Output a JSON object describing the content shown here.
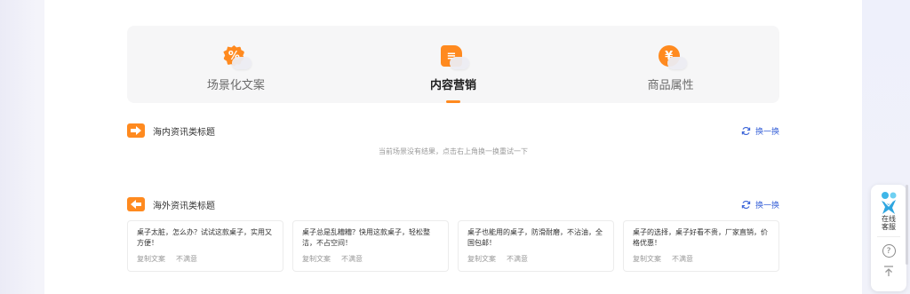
{
  "tabs": [
    {
      "label": "场景化文案",
      "icon": "percent-badge-icon",
      "glyph": "%"
    },
    {
      "label": "内容营销",
      "icon": "document-edit-icon",
      "glyph": "≡"
    },
    {
      "label": "商品属性",
      "icon": "yuan-coin-icon",
      "glyph": "¥"
    }
  ],
  "active_tab": "内容营销",
  "accent_color": "#ff8a1f",
  "link_color": "#3a63d8",
  "domestic": {
    "title": "海内资讯类标题",
    "refresh_label": "换一换",
    "empty_message": "当前场景没有结果，点击右上角换一换重试一下"
  },
  "overseas": {
    "title": "海外资讯类标题",
    "refresh_label": "换一换",
    "cards": [
      {
        "text": "桌子太脏，怎么办？试试这款桌子，实用又方便！",
        "copy": "复制文案",
        "dislike": "不满意"
      },
      {
        "text": "桌子总是乱糟糟？快用这款桌子，轻松整洁，不占空间！",
        "copy": "复制文案",
        "dislike": "不满意"
      },
      {
        "text": "桌子也能用的桌子，防滑耐磨，不沾油，全国包邮！",
        "copy": "复制文案",
        "dislike": "不满意"
      },
      {
        "text": "桌子的选择，桌子好看不贵，厂家直销，价格优惠！",
        "copy": "复制文案",
        "dislike": "不满意"
      }
    ]
  },
  "float_widget": {
    "service_label": "在线客服",
    "help_glyph": "?"
  }
}
